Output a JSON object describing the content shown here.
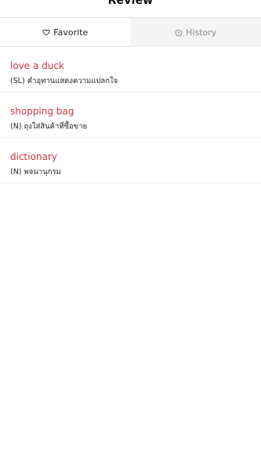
{
  "header": {
    "title": "Review"
  },
  "tabs": [
    {
      "label": "Favorite",
      "icon": "heart-icon",
      "active": true
    },
    {
      "label": "History",
      "icon": "clock-icon",
      "active": false
    }
  ],
  "entries": [
    {
      "word": "love a duck",
      "meaning": "(SL) คำอุทานแสดงความแปลกใจ"
    },
    {
      "word": "shopping bag",
      "meaning": "(N) ถุงใส่สินค้าที่ซื้อขาย"
    },
    {
      "word": "dictionary",
      "meaning": "(N) พจนานุกรม"
    }
  ],
  "colors": {
    "accent": "#d1343e",
    "divider": "#efefef",
    "inactive_tab_bg": "#f4f4f4"
  }
}
